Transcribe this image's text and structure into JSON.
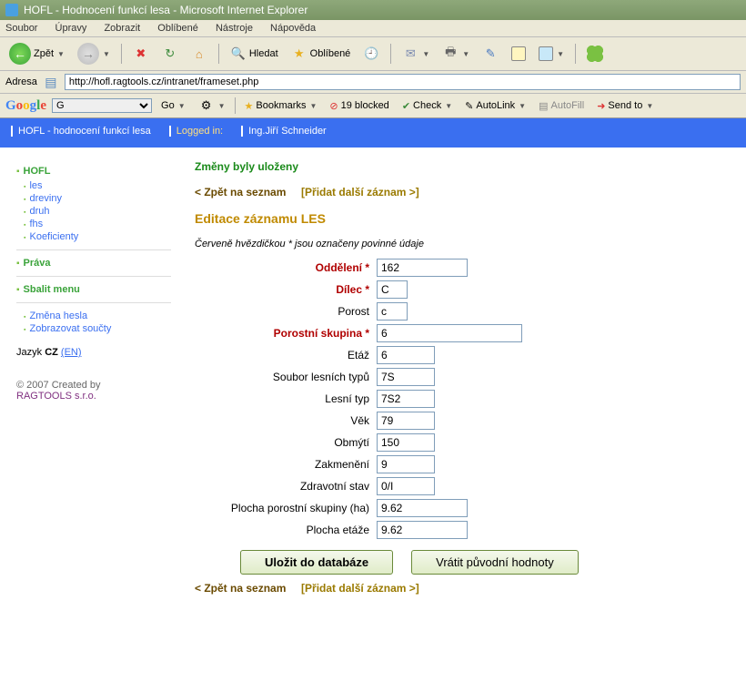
{
  "window": {
    "title": "HOFL - Hodnocení funkcí lesa - Microsoft Internet Explorer"
  },
  "menubar": [
    "Soubor",
    "Úpravy",
    "Zobrazit",
    "Oblíbené",
    "Nástroje",
    "Nápověda"
  ],
  "toolbar": {
    "back": "Zpět",
    "search": "Hledat",
    "favorites": "Oblíbené"
  },
  "address": {
    "label": "Adresa",
    "url": "http://hofl.ragtools.cz/intranet/frameset.php"
  },
  "googlebar": {
    "go": "Go",
    "bookmarks": "Bookmarks",
    "blocked": "19 blocked",
    "check": "Check",
    "autolink": "AutoLink",
    "autofill": "AutoFill",
    "sendto": "Send to"
  },
  "appbar": {
    "title": "HOFL - hodnocení funkcí lesa",
    "logged_label": "Logged in:",
    "user": "Ing.Jiří Schneider"
  },
  "sidebar": {
    "hofl_head": "HOFL",
    "hofl_items": [
      "les",
      "dreviny",
      "druh",
      "fhs",
      "Koeficienty"
    ],
    "prava_head": "Práva",
    "sbalit_head": "Sbalit menu",
    "sbalit_items": [
      "Změna hesla",
      "Zobrazovat součty"
    ],
    "lang_label": "Jazyk",
    "lang_cur": "CZ",
    "lang_alt": "(EN)",
    "credit_prefix": "© 2007 Created by",
    "credit_link": "RAGTOOLS s.r.o."
  },
  "main": {
    "saved_msg": "Změny byly uloženy",
    "back_link": "< Zpět na seznam",
    "add_link": "[Přidat další záznam >]",
    "title": "Editace záznamu LES",
    "note": "Červeně hvězdičkou * jsou označeny povinné údaje",
    "fields": {
      "oddeleni": {
        "label": "Oddělení *",
        "value": "162"
      },
      "dilec": {
        "label": "Dílec *",
        "value": "C"
      },
      "porost": {
        "label": "Porost",
        "value": "c"
      },
      "porostni_skupina": {
        "label": "Porostní skupina *",
        "value": "6"
      },
      "etaz": {
        "label": "Etáž",
        "value": "6"
      },
      "soubor_lesnich_typu": {
        "label": "Soubor lesních typů",
        "value": "7S"
      },
      "lesni_typ": {
        "label": "Lesní typ",
        "value": "7S2"
      },
      "vek": {
        "label": "Věk",
        "value": "79"
      },
      "obmyti": {
        "label": "Obmýtí",
        "value": "150"
      },
      "zakmeneni": {
        "label": "Zakmenění",
        "value": "9"
      },
      "zdravotni_stav": {
        "label": "Zdravotní stav",
        "value": "0/I"
      },
      "plocha_skupiny": {
        "label": "Plocha porostní skupiny (ha)",
        "value": "9.62"
      },
      "plocha_etaze": {
        "label": "Plocha etáže",
        "value": "9.62"
      }
    },
    "btn_save": "Uložit do databáze",
    "btn_reset": "Vrátit původní hodnoty"
  }
}
